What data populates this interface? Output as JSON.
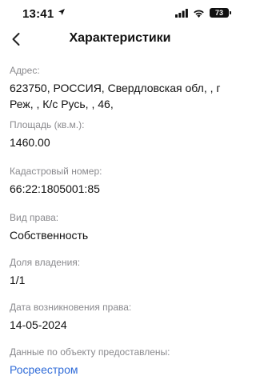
{
  "status_bar": {
    "time": "13:41",
    "battery": "73"
  },
  "header": {
    "title": "Характеристики"
  },
  "fields": [
    {
      "label": "Адрес:",
      "value": "623750, РОССИЯ, Свердловская обл, , г Реж, , К/с Русь, , 46,"
    },
    {
      "label": "Площадь (кв.м.):",
      "value": "1460.00"
    },
    {
      "label": "Кадастровый номер:",
      "value": "66:22:1805001:85"
    },
    {
      "label": "Вид права:",
      "value": "Собственность"
    },
    {
      "label": "Доля владения:",
      "value": "1/1"
    },
    {
      "label": "Дата возникновения права:",
      "value": "14-05-2024"
    },
    {
      "label": "Данные по объекту предоставлены:",
      "value": "Росреестром"
    }
  ],
  "colors": {
    "label": "#8a8a8e",
    "link": "#2f6bd8"
  }
}
